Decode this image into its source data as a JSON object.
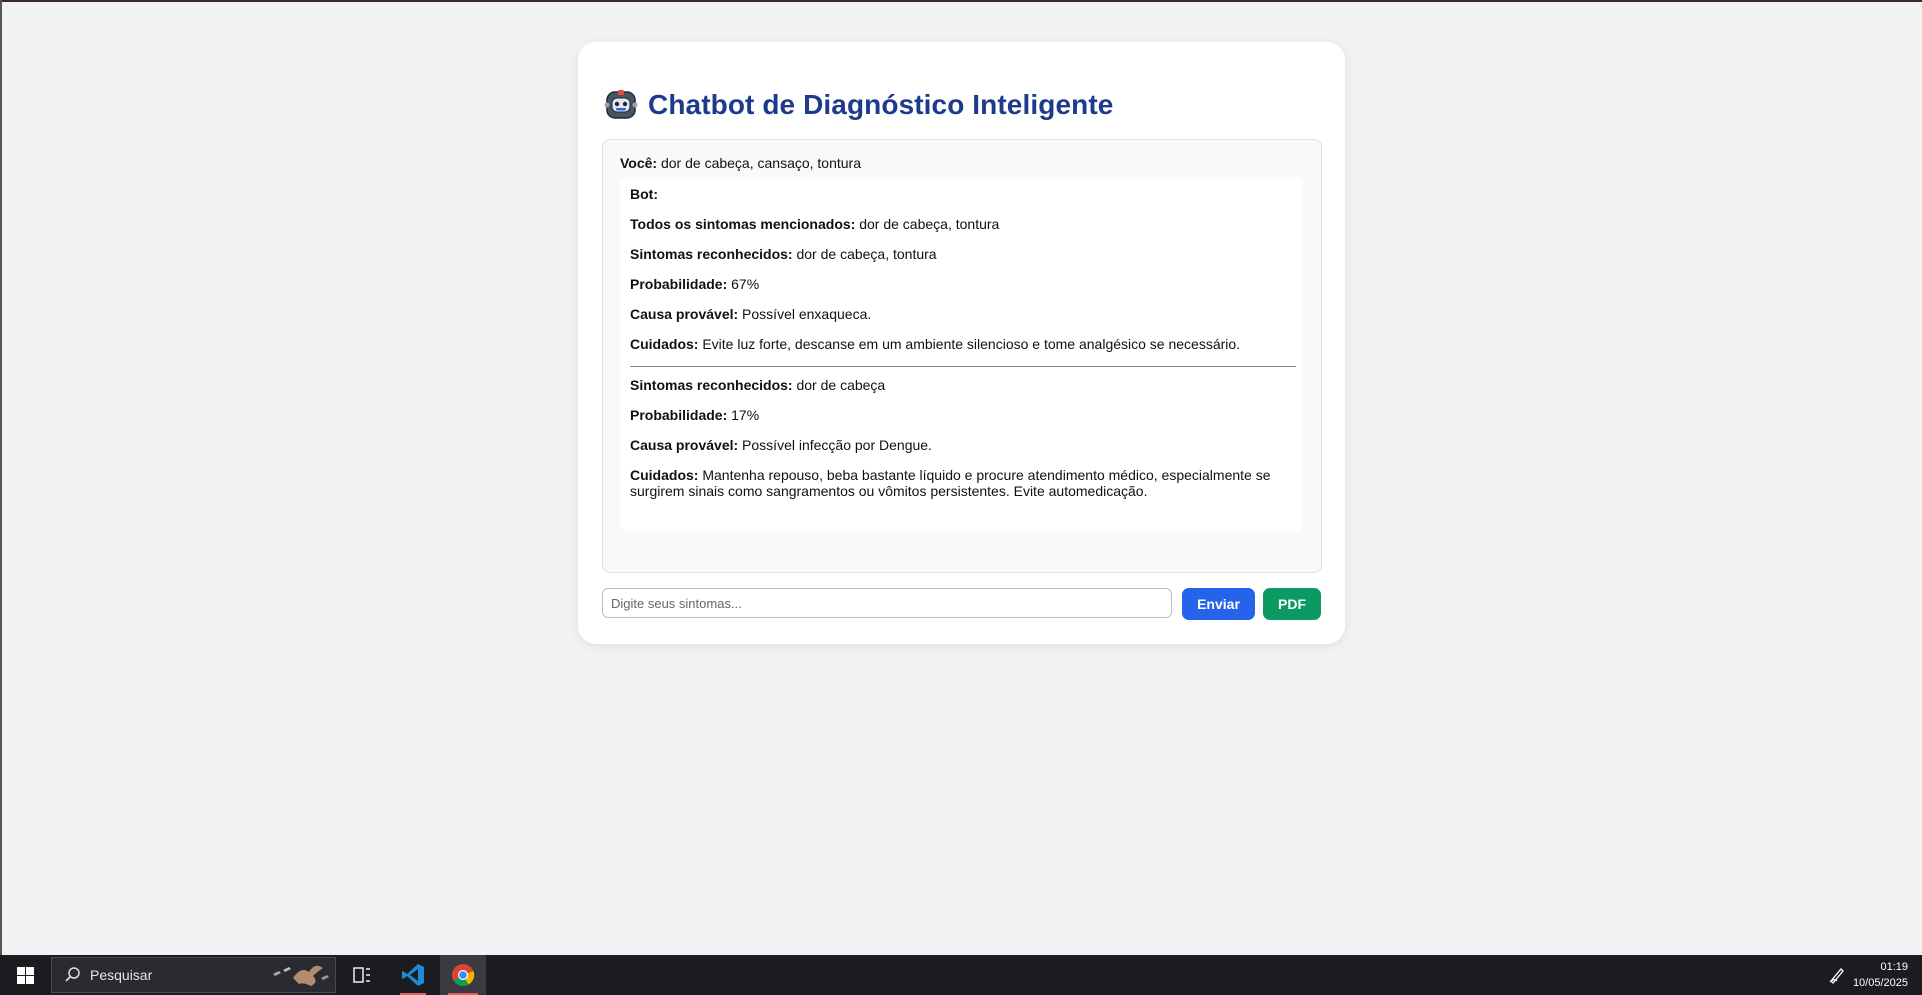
{
  "app": {
    "title": "Chatbot de Diagnóstico Inteligente",
    "robot_icon": "robot-face-icon"
  },
  "chat": {
    "user_label": "Você:",
    "user_text": " dor de cabeça, cansaço, tontura",
    "bot_label": "Bot:",
    "mentioned_label": "Todos os sintomas mencionados:",
    "mentioned_value": " dor de cabeça, tontura",
    "results": [
      {
        "recognized_label": "Sintomas reconhecidos:",
        "recognized_value": " dor de cabeça, tontura",
        "probability_label": "Probabilidade:",
        "probability_value": " 67%",
        "cause_label": "Causa provável:",
        "cause_value": " Possível enxaqueca.",
        "care_label": "Cuidados:",
        "care_value": " Evite luz forte, descanse em um ambiente silencioso e tome analgésico se necessário."
      },
      {
        "recognized_label": "Sintomas reconhecidos:",
        "recognized_value": " dor de cabeça",
        "probability_label": "Probabilidade:",
        "probability_value": " 17%",
        "cause_label": "Causa provável:",
        "cause_value": " Possível infecção por Dengue.",
        "care_label": "Cuidados:",
        "care_value": " Mantenha repouso, beba bastante líquido e procure atendimento médico, especialmente se surgirem sinais como sangramentos ou vômitos persistentes. Evite automedicação."
      }
    ]
  },
  "input": {
    "placeholder": "Digite seus sintomas...",
    "value": ""
  },
  "buttons": {
    "send": "Enviar",
    "pdf": "PDF"
  },
  "colors": {
    "title": "#1e3a8a",
    "send": "#2563eb",
    "pdf": "#0a9a62",
    "background": "#f1f2f4"
  },
  "taskbar": {
    "start_icon": "windows-start-icon",
    "search_placeholder": "Pesquisar",
    "task_view_icon": "task-view-icon",
    "apps": [
      "vscode-icon",
      "chrome-icon"
    ],
    "pen_icon": "pen-icon",
    "time": "01:19",
    "date": "10/05/2025"
  }
}
